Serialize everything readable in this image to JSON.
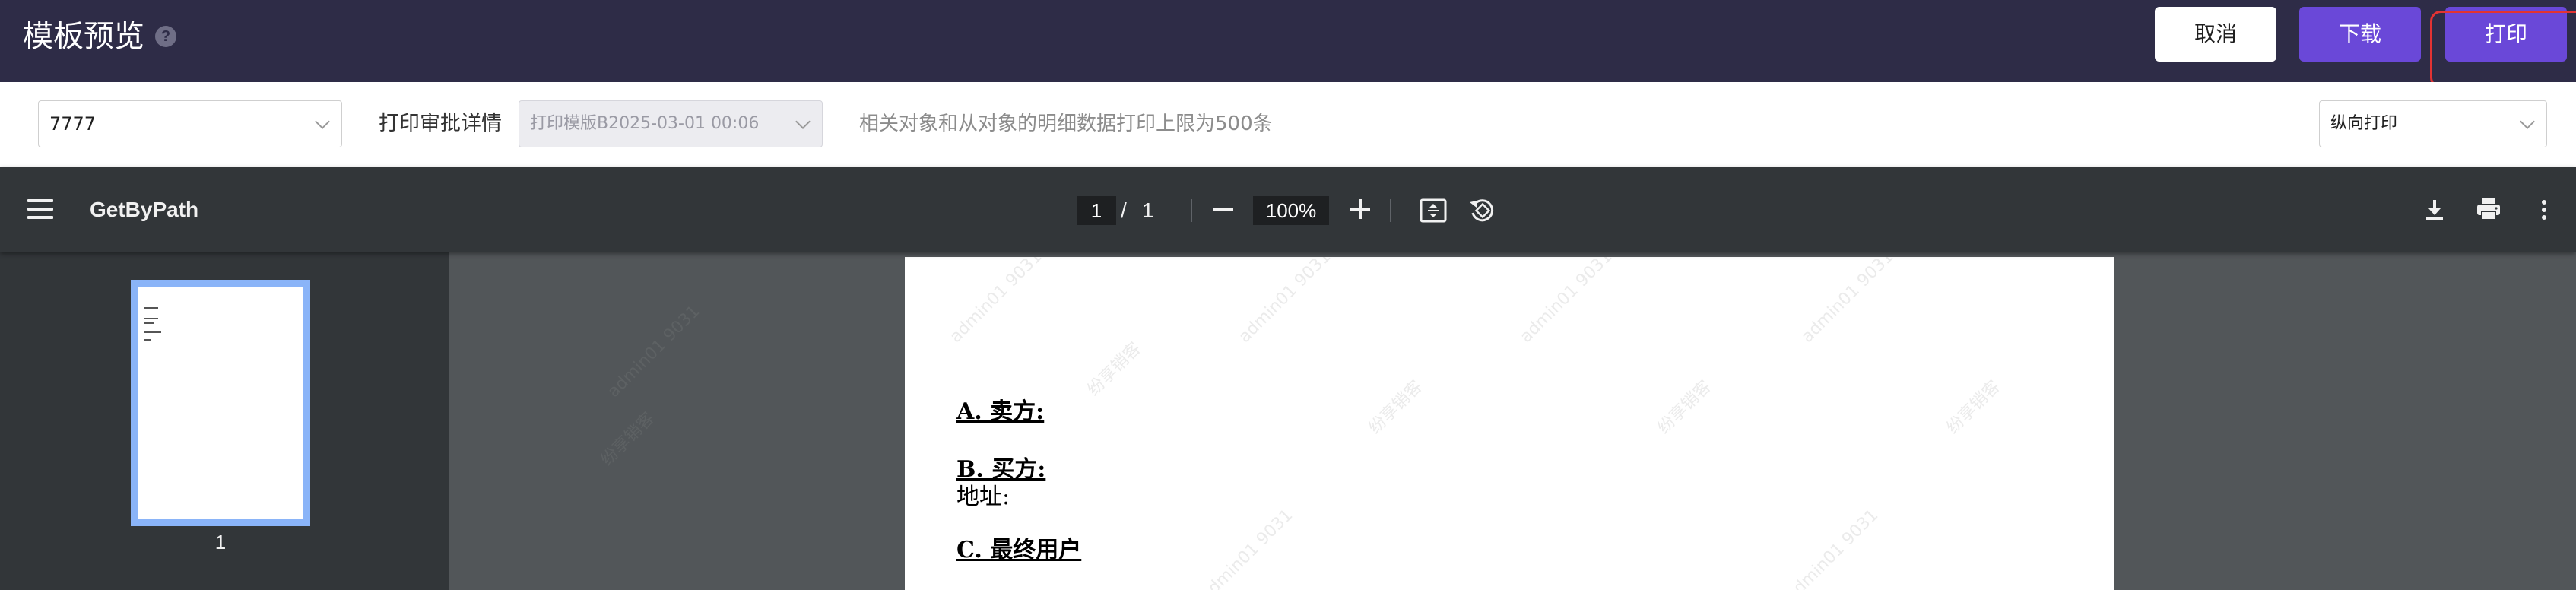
{
  "header": {
    "title": "模板预览",
    "help_icon": "question-circle-icon",
    "buttons": {
      "cancel": "取消",
      "download": "下载",
      "print": "打印"
    }
  },
  "filter": {
    "record_value": "7777",
    "detail_label": "打印审批详情",
    "template_value": "打印模版B2025-03-01 00:06",
    "note": "相关对象和从对象的明细数据打印上限为500条",
    "orientation_value": "纵向打印"
  },
  "viewer": {
    "doc_name": "GetByPath",
    "current_page": "1",
    "separator": "/",
    "total_pages": "1",
    "zoom": "100%",
    "icons": [
      "menu-icon",
      "zoom-out-icon",
      "zoom-in-icon",
      "fit-page-icon",
      "rotate-icon",
      "download-icon",
      "print-icon",
      "more-vertical-icon"
    ]
  },
  "thumbnails": [
    {
      "page_number": "1"
    }
  ],
  "document": {
    "lines": [
      {
        "text": "A. 卖方:",
        "style": "heading"
      },
      {
        "text": "B. 买方:",
        "style": "heading"
      },
      {
        "text": "地址:",
        "style": "normal"
      },
      {
        "text": "C. 最终用户",
        "style": "heading"
      }
    ],
    "watermark_user": "admin01 9031",
    "watermark_org": "纷享销客"
  },
  "colors": {
    "header_bg": "#2e2c47",
    "primary": "#6a48d8",
    "viewer_toolbar": "#323639",
    "viewer_canvas": "#525659",
    "highlight": "#e33333",
    "thumb_border": "#8ab4f8"
  }
}
